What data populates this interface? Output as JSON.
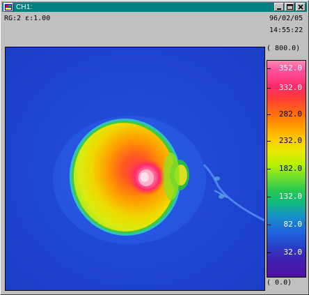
{
  "window": {
    "title": "CH1:"
  },
  "status": {
    "range_text": "RG:2  ε:1.00",
    "date": "96/02/05",
    "time": "14:55:22"
  },
  "scale": {
    "max_label": "( 800.0)",
    "min_label": "( 0.0)",
    "ticks": [
      "352.0",
      "332.0",
      "282.0",
      "232.0",
      "182.0",
      "132.0",
      "82.0",
      "32.0"
    ]
  },
  "icons": [
    "app-icon",
    "minimize-icon",
    "maximize-icon",
    "close-icon"
  ],
  "colors": {
    "titlebar": "#008080",
    "background": "#1e46d2"
  }
}
